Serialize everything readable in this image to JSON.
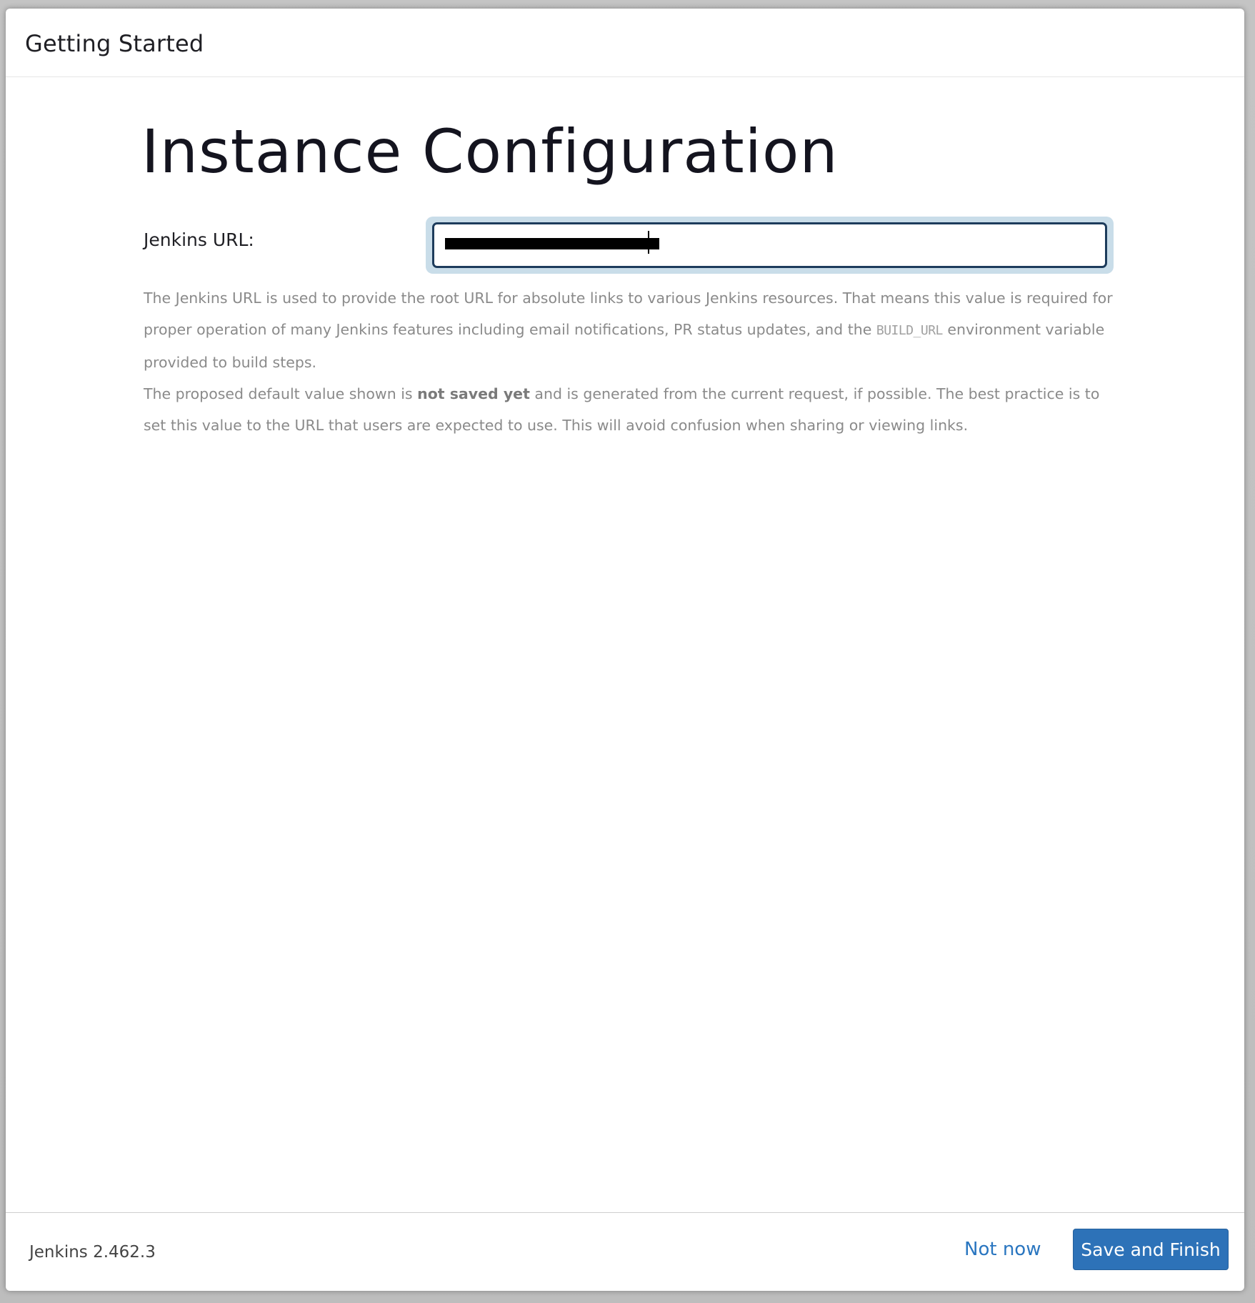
{
  "dialog": {
    "title": "Getting Started"
  },
  "main": {
    "page_title": "Instance Configuration",
    "url_field": {
      "label": "Jenkins URL:",
      "value": ""
    },
    "help": {
      "p1_before_code": "The Jenkins URL is used to provide the root URL for absolute links to various Jenkins resources. That means this value is required for proper operation of many Jenkins features including email notifications, PR status updates, and the ",
      "p1_code": "BUILD_URL",
      "p1_after_code": " environment variable provided to build steps.",
      "p2_before_bold": "The proposed default value shown is ",
      "p2_bold": "not saved yet",
      "p2_after_bold": " and is generated from the current request, if possible. The best practice is to set this value to the URL that users are expected to use. This will avoid confusion when sharing or viewing links."
    }
  },
  "footer": {
    "version": "Jenkins 2.462.3",
    "not_now_label": "Not now",
    "save_finish_label": "Save and Finish"
  },
  "colors": {
    "primary": "#2d72b8",
    "link": "#2a76c0",
    "focus_ring": "#c9dde9",
    "input_border": "#1d3c5c"
  }
}
